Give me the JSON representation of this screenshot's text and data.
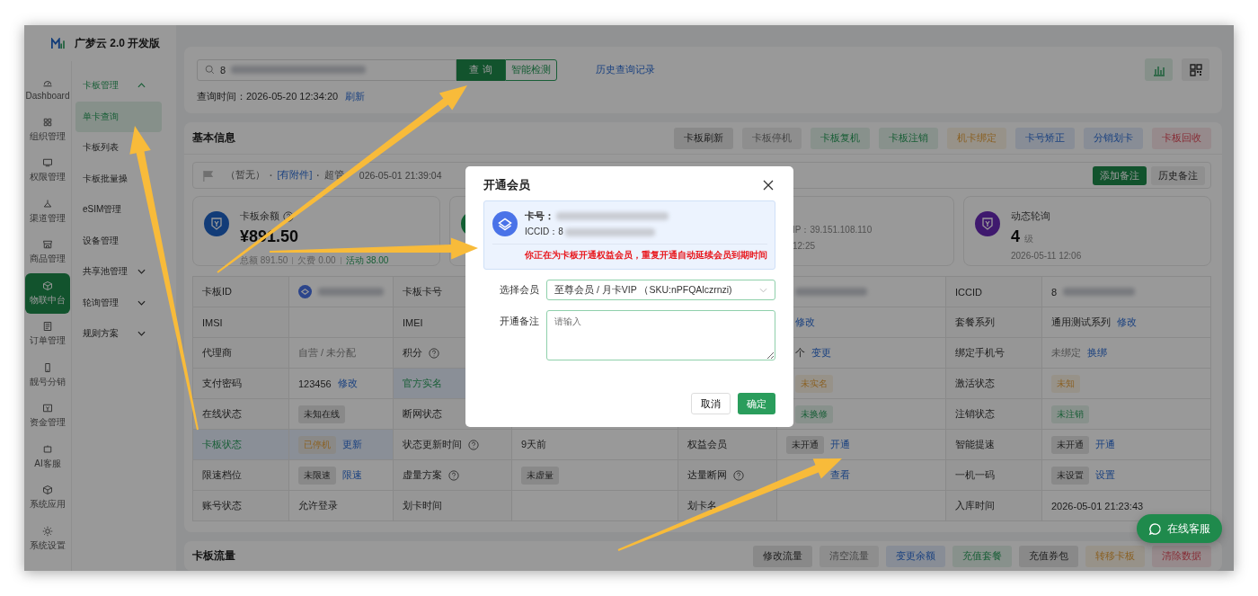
{
  "app": {
    "logo_text": "广梦云 2.0 开发版"
  },
  "rail": [
    {
      "label": "Dashboard",
      "selected": false
    },
    {
      "label": "组织管理",
      "selected": false
    },
    {
      "label": "权限管理",
      "selected": false
    },
    {
      "label": "渠道管理",
      "selected": false
    },
    {
      "label": "商品管理",
      "selected": false
    },
    {
      "label": "物联中台",
      "selected": true
    },
    {
      "label": "订单管理",
      "selected": false
    },
    {
      "label": "靓号分销",
      "selected": false
    },
    {
      "label": "资金管理",
      "selected": false
    },
    {
      "label": "AI客服",
      "selected": false
    },
    {
      "label": "系统应用",
      "selected": false
    },
    {
      "label": "系统设置",
      "selected": false
    }
  ],
  "sidebar": {
    "items": [
      {
        "label": "卡板管理",
        "expanded": true,
        "children": [
          {
            "label": "单卡查询",
            "selected": true
          },
          {
            "label": "卡板列表",
            "selected": false
          },
          {
            "label": "卡板批量操",
            "selected": false
          }
        ]
      },
      {
        "label": "eSIM管理"
      },
      {
        "label": "设备管理"
      },
      {
        "label": "共享池管理",
        "expanded": false
      },
      {
        "label": "轮询管理",
        "expanded": false
      },
      {
        "label": "规则方案",
        "expanded": false
      }
    ]
  },
  "search": {
    "value": "8",
    "query_button": "查 询",
    "detect_button": "智能检测",
    "history_link": "历史查询记录",
    "time_label": "查询时间：2026-05-20 12:34:20",
    "refresh_link": "刷新"
  },
  "basic_info": {
    "title": "基本信息",
    "actions": [
      {
        "label": "卡板刷新",
        "kind": "dark"
      },
      {
        "label": "卡板停机",
        "kind": "grey"
      },
      {
        "label": "卡板复机",
        "kind": "green"
      },
      {
        "label": "卡板注销",
        "kind": "green"
      },
      {
        "label": "机卡绑定",
        "kind": "orange"
      },
      {
        "label": "卡号矫正",
        "kind": "blue"
      },
      {
        "label": "分销划卡",
        "kind": "blue"
      },
      {
        "label": "卡板回收",
        "kind": "red"
      }
    ],
    "note": {
      "parts": [
        {
          "kind": "text",
          "text": "（暂无）"
        },
        {
          "kind": "sep",
          "text": "·"
        },
        {
          "kind": "link",
          "text": "[有附件]"
        },
        {
          "kind": "sep",
          "text": "·"
        },
        {
          "kind": "text",
          "text": "超管"
        },
        {
          "kind": "text",
          "text": "026-05-01 21:39:04"
        }
      ],
      "add_button": "添加备注",
      "history_button": "历史备注"
    },
    "stats": [
      {
        "kind": "balance",
        "title": "卡板余额",
        "help": true,
        "value": "¥891.50",
        "details": [
          {
            "text": "总额 891.50",
            "kind": "muted"
          },
          {
            "text": "欠费 0.00",
            "kind": "muted"
          },
          {
            "text": "活动 38.00",
            "kind": "accent"
          }
        ]
      },
      {
        "kind": "network"
      },
      {
        "kind": "address",
        "lines": [
          "IP：39.151.108.110",
          "12:25"
        ]
      },
      {
        "kind": "polling",
        "title": "动态轮询",
        "value": "4",
        "unit": "级",
        "lines": [
          "2026-05-11 12:06"
        ]
      }
    ],
    "rows": [
      {
        "cells": [
          {
            "highlight": false,
            "parts": [
              {
                "kind": "label",
                "text": "卡板ID"
              }
            ]
          },
          {
            "highlight": false,
            "parts": [
              {
                "kind": "carrier"
              },
              {
                "kind": "blur"
              }
            ]
          },
          {
            "highlight": false,
            "parts": [
              {
                "kind": "label",
                "text": "卡板卡号"
              }
            ]
          },
          {},
          {},
          {
            "highlight": false,
            "parts": [
              {
                "kind": "blur"
              }
            ]
          },
          {
            "highlight": false,
            "parts": [
              {
                "kind": "label",
                "text": "ICCID"
              }
            ]
          },
          {
            "highlight": false,
            "parts": [
              {
                "kind": "text",
                "text": "8"
              },
              {
                "kind": "blur"
              }
            ]
          }
        ]
      },
      {
        "cells": [
          {
            "highlight": false,
            "parts": [
              {
                "kind": "label",
                "text": "IMSI"
              }
            ]
          },
          {
            "highlight": false
          },
          {
            "highlight": false,
            "parts": [
              {
                "kind": "label",
                "text": "IMEI"
              }
            ]
          },
          {},
          {},
          {
            "highlight": false,
            "parts": [
              {
                "kind": "link",
                "text": "修改"
              }
            ]
          },
          {
            "highlight": false,
            "parts": [
              {
                "kind": "label",
                "text": "套餐系列"
              }
            ]
          },
          {
            "highlight": false,
            "parts": [
              {
                "kind": "text",
                "text": "通用测试系列"
              },
              {
                "kind": "link",
                "text": "修改"
              }
            ]
          }
        ]
      },
      {
        "cells": [
          {
            "highlight": false,
            "parts": [
              {
                "kind": "label",
                "text": "代理商"
              }
            ]
          },
          {
            "highlight": false,
            "parts": [
              {
                "kind": "muted",
                "text": "自营 / 未分配"
              }
            ]
          },
          {
            "highlight": false,
            "parts": [
              {
                "kind": "label",
                "text": "积分"
              },
              {
                "kind": "help"
              }
            ]
          },
          {},
          {},
          {
            "highlight": false,
            "parts": [
              {
                "kind": "text",
                "text": "个"
              },
              {
                "kind": "link",
                "text": "变更"
              }
            ]
          },
          {
            "highlight": false,
            "parts": [
              {
                "kind": "label",
                "text": "绑定手机号"
              }
            ]
          },
          {
            "highlight": false,
            "parts": [
              {
                "kind": "muted",
                "text": "未绑定"
              },
              {
                "kind": "link",
                "text": "换绑"
              }
            ]
          }
        ]
      },
      {
        "cells": [
          {
            "highlight": false,
            "parts": [
              {
                "kind": "label",
                "text": "支付密码"
              }
            ]
          },
          {
            "highlight": false,
            "parts": [
              {
                "kind": "text",
                "text": "123456"
              },
              {
                "kind": "link",
                "text": "修改"
              }
            ]
          },
          {
            "highlight": true,
            "parts": [
              {
                "kind": "label",
                "text": "官方实名"
              }
            ]
          },
          {},
          {},
          {
            "highlight": false,
            "parts": [
              {
                "kind": "warning",
                "text": "未实名"
              }
            ]
          },
          {
            "highlight": false,
            "parts": [
              {
                "kind": "label",
                "text": "激活状态"
              }
            ]
          },
          {
            "highlight": false,
            "parts": [
              {
                "kind": "warning",
                "text": "未知"
              }
            ]
          }
        ]
      },
      {
        "cells": [
          {
            "highlight": false,
            "parts": [
              {
                "kind": "label",
                "text": "在线状态"
              }
            ]
          },
          {
            "highlight": false,
            "parts": [
              {
                "kind": "neutral",
                "text": "未知在线"
              }
            ]
          },
          {
            "highlight": false,
            "parts": [
              {
                "kind": "label",
                "text": "断网状态"
              }
            ]
          },
          {},
          {},
          {
            "highlight": false,
            "parts": [
              {
                "kind": "success",
                "text": "未换修"
              }
            ]
          },
          {
            "highlight": false,
            "parts": [
              {
                "kind": "label",
                "text": "注销状态"
              }
            ]
          },
          {
            "highlight": false,
            "parts": [
              {
                "kind": "success",
                "text": "未注销"
              }
            ]
          }
        ]
      },
      {
        "cells": [
          {
            "highlight": true,
            "parts": [
              {
                "kind": "label",
                "text": "卡板状态"
              }
            ]
          },
          {
            "highlight": true,
            "parts": [
              {
                "kind": "warning",
                "text": "已停机"
              },
              {
                "kind": "link",
                "text": "更新"
              }
            ]
          },
          {
            "highlight": false,
            "parts": [
              {
                "kind": "label",
                "text": "状态更新时间"
              },
              {
                "kind": "help"
              }
            ]
          },
          {
            "highlight": false,
            "parts": [
              {
                "kind": "text",
                "text": "9天前"
              }
            ]
          },
          {
            "highlight": false,
            "parts": [
              {
                "kind": "label",
                "text": "权益会员"
              }
            ]
          },
          {
            "highlight": false,
            "parts": [
              {
                "kind": "neutral",
                "text": "未开通"
              },
              {
                "kind": "link",
                "text": "开通"
              }
            ]
          },
          {
            "highlight": false,
            "parts": [
              {
                "kind": "label",
                "text": "智能提速"
              }
            ]
          },
          {
            "highlight": false,
            "parts": [
              {
                "kind": "neutral",
                "text": "未开通"
              },
              {
                "kind": "link",
                "text": "开通"
              }
            ]
          }
        ]
      },
      {
        "cells": [
          {
            "highlight": false,
            "parts": [
              {
                "kind": "label",
                "text": "限速档位"
              }
            ]
          },
          {
            "highlight": false,
            "parts": [
              {
                "kind": "neutral",
                "text": "未限速"
              },
              {
                "kind": "link",
                "text": "限速"
              }
            ]
          },
          {
            "highlight": false,
            "parts": [
              {
                "kind": "label",
                "text": "虚量方案"
              },
              {
                "kind": "help"
              }
            ]
          },
          {
            "highlight": false,
            "parts": [
              {
                "kind": "neutral",
                "text": "未虚量"
              }
            ]
          },
          {
            "highlight": false,
            "parts": [
              {
                "kind": "label",
                "text": "达量断网"
              },
              {
                "kind": "help"
              }
            ]
          },
          {
            "highlight": false,
            "parts": [
              {
                "kind": "spacer"
              },
              {
                "kind": "link",
                "text": "查看"
              }
            ]
          },
          {
            "highlight": false,
            "parts": [
              {
                "kind": "label",
                "text": "一机一码"
              }
            ]
          },
          {
            "highlight": false,
            "parts": [
              {
                "kind": "neutral",
                "text": "未设置"
              },
              {
                "kind": "link",
                "text": "设置"
              }
            ]
          }
        ]
      },
      {
        "cells": [
          {
            "highlight": false,
            "parts": [
              {
                "kind": "label",
                "text": "账号状态"
              }
            ]
          },
          {
            "highlight": false,
            "parts": [
              {
                "kind": "text",
                "text": "允许登录"
              }
            ]
          },
          {
            "highlight": false,
            "parts": [
              {
                "kind": "label",
                "text": "划卡时间"
              }
            ]
          },
          {
            "highlight": false
          },
          {
            "highlight": false,
            "parts": [
              {
                "kind": "label",
                "text": "划卡名"
              }
            ]
          },
          {
            "highlight": false
          },
          {
            "highlight": false,
            "parts": [
              {
                "kind": "label",
                "text": "入库时间"
              }
            ]
          },
          {
            "highlight": false,
            "parts": [
              {
                "kind": "text",
                "text": "2026-05-01 21:23:43"
              }
            ]
          }
        ]
      }
    ]
  },
  "traffic": {
    "title": "卡板流量",
    "actions": [
      {
        "label": "修改流量",
        "kind": "dark"
      },
      {
        "label": "清空流量",
        "kind": "grey"
      },
      {
        "label": "变更余额",
        "kind": "blue"
      },
      {
        "label": "充值套餐",
        "kind": "green"
      },
      {
        "label": "充值券包",
        "kind": "dark"
      },
      {
        "label": "转移卡板",
        "kind": "orange"
      },
      {
        "label": "清除数据",
        "kind": "red"
      }
    ]
  },
  "chat_button": "在线客服",
  "dialog": {
    "title": "开通会员",
    "card_label": "卡号：",
    "iccid_label": "ICCID：8",
    "warning": "你正在为卡板开通权益会员，重复开通自动延续会员到期时间",
    "member_label": "选择会员",
    "member_value": "至尊会员 / 月卡VIP （SKU:nPFQAlczrnzi)",
    "note_label": "开通备注",
    "note_placeholder": "请输入",
    "cancel": "取消",
    "confirm": "确定"
  }
}
